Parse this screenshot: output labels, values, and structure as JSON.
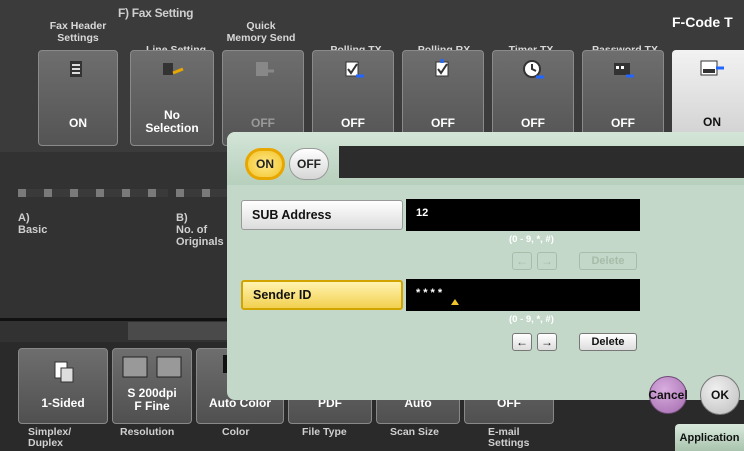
{
  "section_label": "F)  Fax Setting",
  "top_tabs": [
    {
      "label": "Fax Header\nSettings",
      "value": "ON",
      "icon": "fax-header-icon",
      "dim": false
    },
    {
      "label": "Line Setting",
      "value": "No\nSelection",
      "icon": "line-setting-icon",
      "dim": false
    },
    {
      "label": "Quick\nMemory Send",
      "value": "OFF",
      "icon": "quick-memory-send-icon",
      "dim": true
    },
    {
      "label": "Polling TX",
      "value": "OFF",
      "icon": "polling-tx-icon",
      "dim": false
    },
    {
      "label": "Polling RX",
      "value": "OFF",
      "icon": "polling-rx-icon",
      "dim": false
    },
    {
      "label": "Timer TX",
      "value": "OFF",
      "icon": "timer-tx-icon",
      "dim": false
    },
    {
      "label": "Password TX",
      "value": "OFF",
      "icon": "password-tx-icon",
      "dim": false
    },
    {
      "label": "F-Code T",
      "value": "ON",
      "icon": "f-code-tx-icon",
      "dim": false
    }
  ],
  "middle": {
    "a_label": "A)\nBasic",
    "b_label": "B)\nNo. of\nOriginals"
  },
  "bottom": {
    "tiles": [
      {
        "value": "1-Sided",
        "icon": "simplex-icon"
      },
      {
        "value": "S 200dpi\nF Fine",
        "icon": "resolution-icon"
      },
      {
        "value": "Auto Color",
        "icon": "color-icon"
      },
      {
        "value": "PDF",
        "icon": "file-type-icon"
      },
      {
        "value": "Auto",
        "icon": "scan-size-icon"
      },
      {
        "value": "OFF",
        "icon": "email-settings-icon"
      }
    ],
    "labels": [
      "Simplex/\nDuplex",
      "Resolution",
      "Color",
      "File Type",
      "Scan Size",
      "E-mail\nSettings"
    ]
  },
  "dialog": {
    "on_label": "ON",
    "off_label": "OFF",
    "sub_address_label": "SUB Address",
    "sub_address_value": "12",
    "sub_address_hint": "(0 - 9, *, #)",
    "sender_id_label": "Sender ID",
    "sender_id_value": "****",
    "sender_id_hint": "(0 - 9, *, #)",
    "left_arrow": "←",
    "right_arrow": "→",
    "delete_label": "Delete"
  },
  "footer": {
    "cancel_label": "Cancel",
    "ok_label": "OK",
    "application_label": "Application"
  },
  "colors": {
    "dialog_bg": "#c3d8c9",
    "selected_yellow": "#f2d050",
    "cancel_purple": "#a26aad"
  }
}
